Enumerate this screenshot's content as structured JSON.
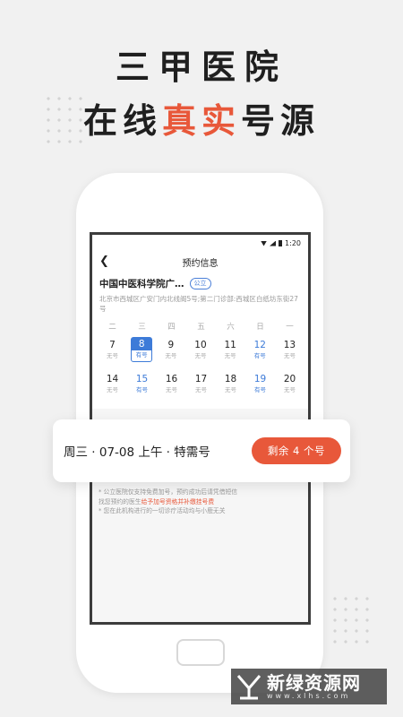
{
  "headline": {
    "line1": "三甲医院",
    "line2_pre": "在线",
    "line2_accent": "真实",
    "line2_post": "号源"
  },
  "status_bar": {
    "time": "1:20"
  },
  "nav": {
    "title": "预约信息"
  },
  "hospital": {
    "name": "中国中医科学院广…",
    "badge": "公立",
    "address": "北京市西城区广安门内北线阁5号;第二门诊部:西城区白纸坊东街27号"
  },
  "weekdays": [
    "二",
    "三",
    "四",
    "五",
    "六",
    "日",
    "一"
  ],
  "calendar": [
    [
      {
        "day": "7",
        "status": "无号",
        "have": false,
        "selected": false
      },
      {
        "day": "8",
        "status": "有号",
        "have": true,
        "selected": true
      },
      {
        "day": "9",
        "status": "无号",
        "have": false,
        "selected": false
      },
      {
        "day": "10",
        "status": "无号",
        "have": false,
        "selected": false
      },
      {
        "day": "11",
        "status": "无号",
        "have": false,
        "selected": false
      },
      {
        "day": "12",
        "status": "有号",
        "have": true,
        "selected": false
      },
      {
        "day": "13",
        "status": "无号",
        "have": false,
        "selected": false
      }
    ],
    [
      {
        "day": "14",
        "status": "无号",
        "have": false,
        "selected": false
      },
      {
        "day": "15",
        "status": "有号",
        "have": true,
        "selected": false
      },
      {
        "day": "16",
        "status": "无号",
        "have": false,
        "selected": false
      },
      {
        "day": "17",
        "status": "无号",
        "have": false,
        "selected": false
      },
      {
        "day": "18",
        "status": "无号",
        "have": false,
        "selected": false
      },
      {
        "day": "19",
        "status": "有号",
        "have": true,
        "selected": false
      },
      {
        "day": "20",
        "status": "无号",
        "have": false,
        "selected": false
      }
    ]
  ],
  "slot": {
    "text": "周三 · 07-08 上午 · 特需号",
    "button": "剩余 4 个号"
  },
  "notes": {
    "line1": "* 公立医院仅支持免费加号，预约成功后请凭借短信",
    "line2_pre": "找您预约的医生",
    "line2_red": "给予加号资格并补缴挂号费",
    "line3": "* 您在此机构进行的一切诊疗活动均与小鹿无关"
  },
  "watermark": {
    "name": "新绿资源网",
    "url": "www.xlhs.com"
  },
  "colors": {
    "accent": "#e8583a",
    "blue": "#3d7bd8"
  }
}
